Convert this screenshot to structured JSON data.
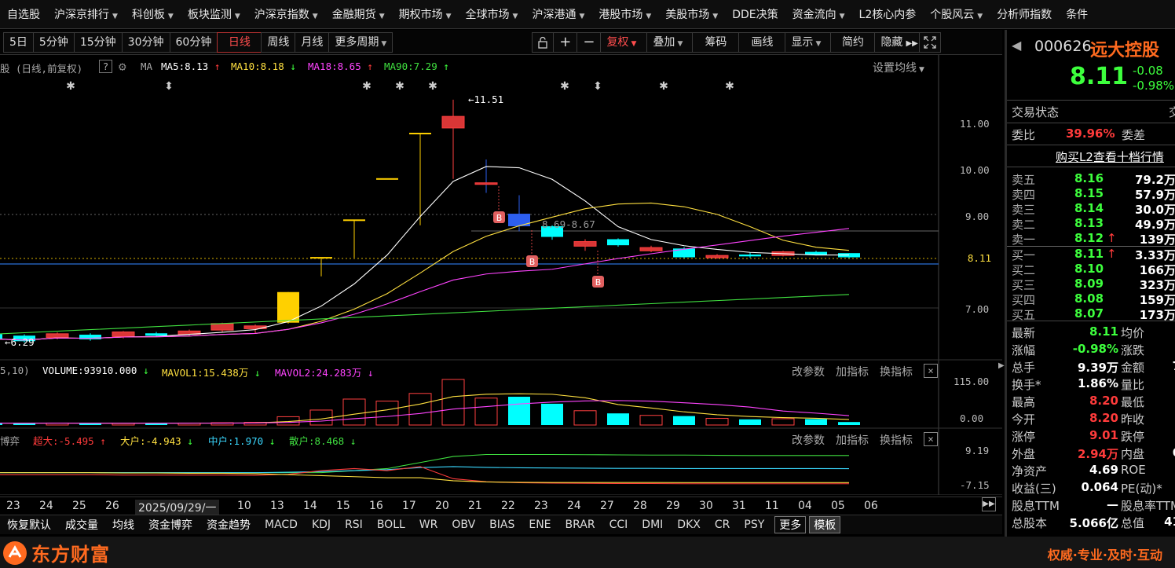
{
  "menu": [
    {
      "label": "自选股",
      "dd": false
    },
    {
      "label": "沪深京排行",
      "dd": true
    },
    {
      "label": "科创板",
      "dd": true
    },
    {
      "label": "板块监测",
      "dd": true
    },
    {
      "label": "沪深京指数",
      "dd": true
    },
    {
      "label": "金融期货",
      "dd": true
    },
    {
      "label": "期权市场",
      "dd": true
    },
    {
      "label": "全球市场",
      "dd": true
    },
    {
      "label": "沪深港通",
      "dd": true
    },
    {
      "label": "港股市场",
      "dd": true
    },
    {
      "label": "美股市场",
      "dd": true
    },
    {
      "label": "DDE决策",
      "dd": false
    },
    {
      "label": "资金流向",
      "dd": true
    },
    {
      "label": "L2核心内参",
      "dd": false
    },
    {
      "label": "个股风云",
      "dd": true
    },
    {
      "label": "分析师指数",
      "dd": false
    },
    {
      "label": "条件",
      "dd": false
    }
  ],
  "toolbar": {
    "periods": [
      "5日",
      "5分钟",
      "15分钟",
      "30分钟",
      "60分钟",
      "日线",
      "周线",
      "月线",
      "更多周期"
    ],
    "active_period": "日线",
    "lock_icon": "lock-icon",
    "plus": "+",
    "minus": "−",
    "fuquan": "复权",
    "diejia": "叠加",
    "chouma": "筹码",
    "huaxian": "画线",
    "xianshi": "显示",
    "jianyue": "简约",
    "yincang": "隐藏",
    "expand_icon": "expand-icon"
  },
  "main_chart": {
    "title": "股 (日线,前复权)",
    "ma_label": "MA",
    "ma5": "MA5:8.13",
    "ma10": "MA10:8.18",
    "ma18": "MA18:8.65",
    "ma90": "MA90:7.29",
    "ma5_arrow": "↑",
    "ma10_arrow": "↓",
    "ma18_arrow": "↑",
    "ma90_arrow": "↑",
    "settings": "设置均线",
    "price_ticks": [
      "11.00",
      "10.00",
      "9.00",
      "8.00",
      "7.00"
    ],
    "current_price_tag": "8.11",
    "high_marker": "←11.51",
    "low_marker": "←6.29",
    "range_label": "8.69-8.67",
    "b_marker": "B"
  },
  "volume_panel": {
    "param": "5,10)",
    "volume": "VOLUME:93910.000",
    "vol_arrow": "↓",
    "mavol1": "MAVOL1:15.438万",
    "mavol1_arrow": "↓",
    "mavol2": "MAVOL2:24.283万",
    "mavol2_arrow": "↓",
    "ticks": [
      "115.00",
      "0.00"
    ],
    "btn_params": "改参数",
    "btn_add": "加指标",
    "btn_switch": "换指标",
    "close": "×"
  },
  "flow_panel": {
    "name": "博弈",
    "cd": "超大:-5.495",
    "cd_arrow": "↑",
    "dh": "大户:-4.943",
    "dh_arrow": "↓",
    "zh": "中户:1.970",
    "zh_arrow": "↓",
    "sh": "散户:8.468",
    "sh_arrow": "↓",
    "ticks": [
      "9.19",
      "-7.15"
    ],
    "btn_params": "改参数",
    "btn_add": "加指标",
    "btn_switch": "换指标",
    "close": "×"
  },
  "dates": [
    "23",
    "24",
    "25",
    "26",
    "2025/09/29/一",
    "10",
    "13",
    "14",
    "15",
    "16",
    "17",
    "20",
    "21",
    "22",
    "23",
    "24",
    "27",
    "28",
    "29",
    "30",
    "31",
    "11",
    "04",
    "05",
    "06"
  ],
  "indicators": [
    "恢复默认",
    "成交量",
    "均线",
    "资金博弈",
    "资金趋势",
    "MACD",
    "KDJ",
    "RSI",
    "BOLL",
    "WR",
    "OBV",
    "BIAS",
    "ENE",
    "BRAR",
    "CCI",
    "DMI",
    "DKX",
    "CR",
    "PSY",
    "更多",
    "模板"
  ],
  "footer": {
    "logo_text": "东方财富",
    "slogan": "权威·专业·及时·互动"
  },
  "quote": {
    "code": "000626",
    "name": "远大控股",
    "price": "8.11",
    "change": "-0.08",
    "change_pct": "-0.98%",
    "status_label": "交易状态",
    "status_right": "交",
    "weibi_label": "委比",
    "weibi": "39.96%",
    "weicha_label": "委差",
    "buy_l2": "购买L2查看十档行情",
    "asks": [
      {
        "label": "卖五",
        "price": "8.16",
        "vol": "79.2万"
      },
      {
        "label": "卖四",
        "price": "8.15",
        "vol": "57.9万"
      },
      {
        "label": "卖三",
        "price": "8.14",
        "vol": "30.0万"
      },
      {
        "label": "卖二",
        "price": "8.13",
        "vol": "49.9万"
      },
      {
        "label": "卖一",
        "price": "8.12",
        "vol": "139万",
        "arrow": "↑"
      }
    ],
    "bids": [
      {
        "label": "买一",
        "price": "8.11",
        "vol": "3.33万",
        "arrow": "↑"
      },
      {
        "label": "买二",
        "price": "8.10",
        "vol": "166万"
      },
      {
        "label": "买三",
        "price": "8.09",
        "vol": "323万"
      },
      {
        "label": "买四",
        "price": "8.08",
        "vol": "159万"
      },
      {
        "label": "买五",
        "price": "8.07",
        "vol": "173万"
      }
    ],
    "stats": [
      {
        "k": "最新",
        "v": "8.11",
        "c": "dn",
        "k2": "均价",
        "v2": ""
      },
      {
        "k": "涨幅",
        "v": "-0.98%",
        "c": "dn",
        "k2": "涨跌",
        "v2": ""
      },
      {
        "k": "总手",
        "v": "9.39万",
        "c": "wh",
        "k2": "金额",
        "v2": "7"
      },
      {
        "k": "换手*",
        "v": "1.86%",
        "c": "wh",
        "k2": "量比",
        "v2": ""
      },
      {
        "k": "最高",
        "v": "8.20",
        "c": "up",
        "k2": "最低",
        "v2": ""
      },
      {
        "k": "今开",
        "v": "8.20",
        "c": "up",
        "k2": "昨收",
        "v2": ""
      },
      {
        "k": "涨停",
        "v": "9.01",
        "c": "up",
        "k2": "跌停",
        "v2": ""
      },
      {
        "k": "外盘",
        "v": "2.94万",
        "c": "up",
        "k2": "内盘",
        "v2": "6"
      },
      {
        "k": "净资产",
        "v": "4.69",
        "c": "wh",
        "k2": "ROE",
        "v2": ""
      },
      {
        "k": "收益(三)",
        "v": "0.064",
        "c": "wh",
        "k2": "PE(动)*",
        "v2": ""
      },
      {
        "k": "股息TTM",
        "v": "—",
        "c": "wh",
        "k2": "股息率TTM",
        "v2": ""
      },
      {
        "k": "总股本",
        "v": "5.066亿",
        "c": "wh",
        "k2": "总值",
        "v2": "41"
      }
    ]
  },
  "candles": [
    {
      "o": 6.45,
      "c": 6.35,
      "h": 6.48,
      "l": 6.31
    },
    {
      "o": 6.42,
      "c": 6.3,
      "h": 6.45,
      "l": 6.27
    },
    {
      "o": 6.38,
      "c": 6.46,
      "h": 6.49,
      "l": 6.34
    },
    {
      "o": 6.44,
      "c": 6.34,
      "h": 6.47,
      "l": 6.31
    },
    {
      "o": 6.4,
      "c": 6.5,
      "h": 6.52,
      "l": 6.36
    },
    {
      "o": 6.47,
      "c": 6.42,
      "h": 6.5,
      "l": 6.4
    },
    {
      "o": 6.45,
      "c": 6.52,
      "h": 6.55,
      "l": 6.42
    },
    {
      "o": 6.54,
      "c": 6.68,
      "h": 6.7,
      "l": 6.5
    },
    {
      "o": 6.57,
      "c": 6.63,
      "h": 6.66,
      "l": 6.47
    },
    {
      "o": 6.7,
      "c": 7.36,
      "h": 7.36,
      "l": 6.68
    },
    {
      "o": 8.1,
      "c": 8.1,
      "h": 8.1,
      "l": 7.7
    },
    {
      "o": 8.91,
      "c": 8.91,
      "h": 8.91,
      "l": 8.1
    },
    {
      "o": 9.8,
      "c": 9.8,
      "h": 9.8,
      "l": 9.8
    },
    {
      "o": 10.78,
      "c": 10.78,
      "h": 10.78,
      "l": 8.8
    },
    {
      "o": 10.9,
      "c": 11.15,
      "h": 11.51,
      "l": 9.8
    },
    {
      "o": 9.7,
      "c": 9.7,
      "h": 10.22,
      "l": 9.5
    },
    {
      "o": 9.05,
      "c": 8.78,
      "h": 9.45,
      "l": 8.67
    },
    {
      "o": 8.78,
      "c": 8.55,
      "h": 8.8,
      "l": 8.49
    },
    {
      "o": 8.35,
      "c": 8.45,
      "h": 8.5,
      "l": 8.25
    },
    {
      "o": 8.5,
      "c": 8.37,
      "h": 8.52,
      "l": 8.34
    },
    {
      "o": 8.25,
      "c": 8.32,
      "h": 8.36,
      "l": 8.22
    },
    {
      "o": 8.3,
      "c": 8.11,
      "h": 8.33,
      "l": 8.09
    },
    {
      "o": 8.1,
      "c": 8.15,
      "h": 8.18,
      "l": 8.08
    },
    {
      "o": 8.17,
      "c": 8.13,
      "h": 8.21,
      "l": 8.1
    },
    {
      "o": 8.15,
      "c": 8.23,
      "h": 8.25,
      "l": 8.13
    },
    {
      "o": 8.21,
      "c": 8.18,
      "h": 8.25,
      "l": 8.15
    },
    {
      "o": 8.2,
      "c": 8.11,
      "h": 8.2,
      "l": 8.09
    }
  ],
  "volumes": [
    6,
    5,
    6,
    5,
    5,
    6,
    6,
    7,
    8,
    25,
    45,
    78,
    72,
    95,
    137,
    81,
    85,
    64,
    43,
    35,
    29,
    27,
    20,
    17,
    19,
    18,
    9
  ]
}
